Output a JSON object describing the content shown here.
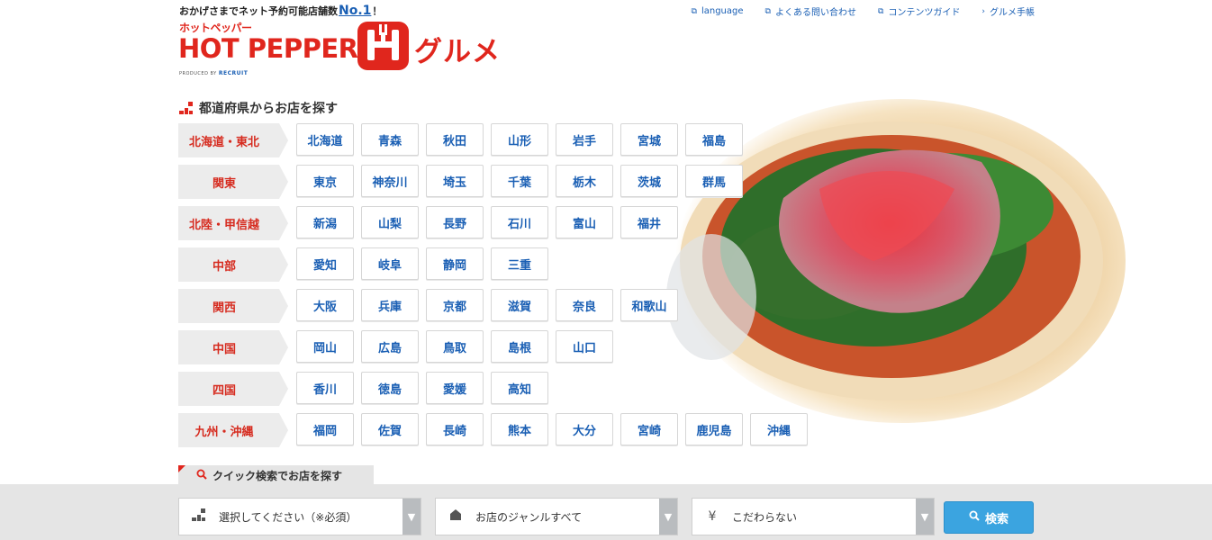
{
  "header": {
    "tagline_pre": "おかげさまでネット予約可能店舗数",
    "tagline_hl": "No.1",
    "tagline_post": "！",
    "logo_kana": "ホットペッパー",
    "logo_word": "HOT PEPPER",
    "logo_gurume": "グルメ",
    "produced_by": "PRODUCED BY",
    "produced_brand": "RECRUIT",
    "links": [
      {
        "label": "language",
        "icon": "external-link-icon"
      },
      {
        "label": "よくある問い合わせ",
        "icon": "external-link-icon"
      },
      {
        "label": "コンテンツガイド",
        "icon": "external-link-icon"
      },
      {
        "label": "グルメ手帳",
        "icon": "chevron-right-icon"
      }
    ]
  },
  "prefecture_search": {
    "title": "都道府県からお店を探す",
    "regions": [
      {
        "name": "北海道・東北",
        "prefs": [
          "北海道",
          "青森",
          "秋田",
          "山形",
          "岩手",
          "宮城",
          "福島"
        ]
      },
      {
        "name": "関東",
        "prefs": [
          "東京",
          "神奈川",
          "埼玉",
          "千葉",
          "栃木",
          "茨城",
          "群馬"
        ]
      },
      {
        "name": "北陸・甲信越",
        "prefs": [
          "新潟",
          "山梨",
          "長野",
          "石川",
          "富山",
          "福井"
        ]
      },
      {
        "name": "中部",
        "prefs": [
          "愛知",
          "岐阜",
          "静岡",
          "三重"
        ]
      },
      {
        "name": "関西",
        "prefs": [
          "大阪",
          "兵庫",
          "京都",
          "滋賀",
          "奈良",
          "和歌山"
        ]
      },
      {
        "name": "中国",
        "prefs": [
          "岡山",
          "広島",
          "鳥取",
          "島根",
          "山口"
        ]
      },
      {
        "name": "四国",
        "prefs": [
          "香川",
          "徳島",
          "愛媛",
          "高知"
        ]
      },
      {
        "name": "九州・沖縄",
        "prefs": [
          "福岡",
          "佐賀",
          "長崎",
          "熊本",
          "大分",
          "宮崎",
          "鹿児島",
          "沖縄"
        ]
      }
    ]
  },
  "quick_search": {
    "tab_label": "クイック検索でお店を探す",
    "area_select": "選択してください（※必須）",
    "genre_select": "お店のジャンルすべて",
    "budget_select": "こだわらない",
    "budget_icon_glyph": "¥",
    "search_button": "検索"
  },
  "colors": {
    "brand_red": "#e0261d",
    "link_blue": "#1a5fb4",
    "button_blue": "#3ba4e0"
  }
}
